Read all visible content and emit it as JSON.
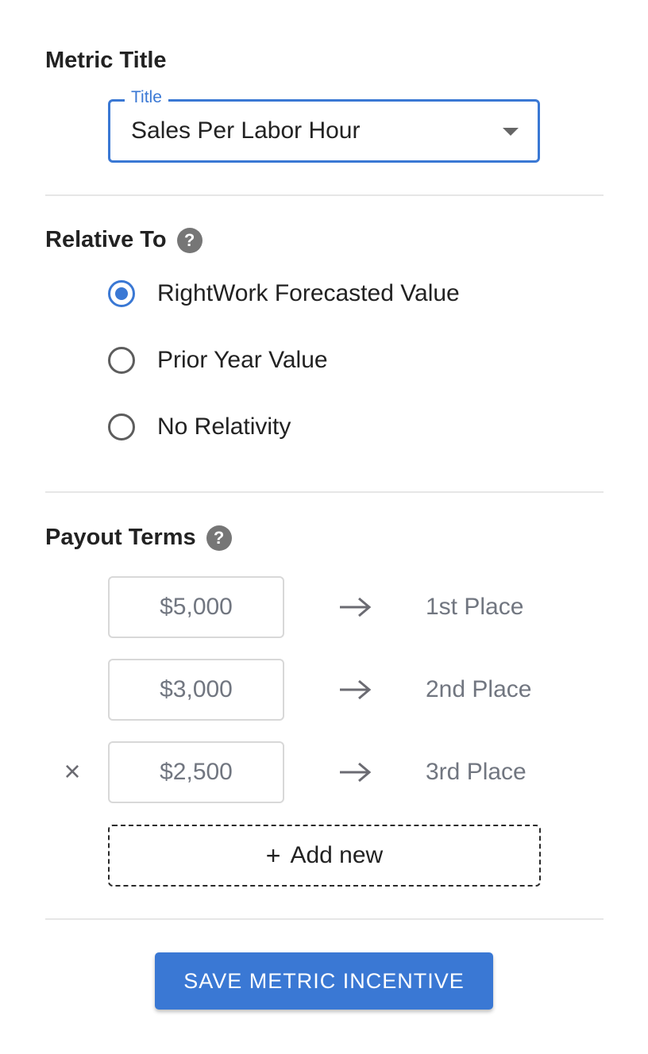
{
  "metric_title": {
    "heading": "Metric Title",
    "select_label": "Title",
    "select_value": "Sales Per Labor Hour"
  },
  "relative_to": {
    "heading": "Relative To",
    "options": [
      {
        "label": "RightWork Forecasted Value",
        "selected": true
      },
      {
        "label": "Prior Year Value",
        "selected": false
      },
      {
        "label": "No Relativity",
        "selected": false
      }
    ]
  },
  "payout_terms": {
    "heading": "Payout Terms",
    "rows": [
      {
        "amount": "$5,000",
        "place": "1st Place",
        "removable": false
      },
      {
        "amount": "$3,000",
        "place": "2nd Place",
        "removable": false
      },
      {
        "amount": "$2,500",
        "place": "3rd Place",
        "removable": true
      }
    ],
    "add_plus": "+",
    "add_label": "Add new",
    "remove_glyph": "×"
  },
  "help_glyph": "?",
  "save_label": "SAVE METRIC INCENTIVE",
  "colors": {
    "accent": "#3a78d4",
    "muted_text": "#717680",
    "divider": "#e6e6e6"
  }
}
